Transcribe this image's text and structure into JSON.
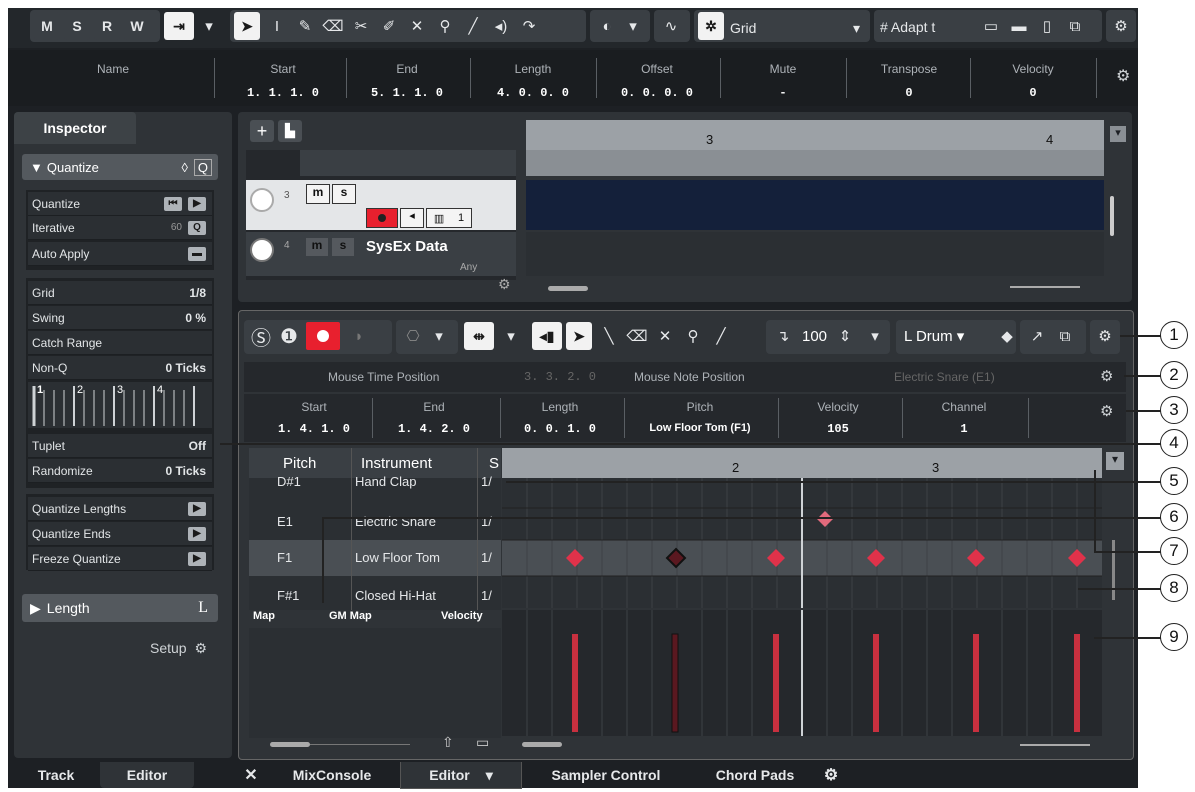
{
  "toolbar": {
    "mode_buttons": [
      "M",
      "S",
      "R",
      "W"
    ],
    "snap_type": "Grid",
    "quantize_preset": "Adapt t"
  },
  "info_line": {
    "columns": [
      {
        "label": "Name",
        "value": ""
      },
      {
        "label": "Start",
        "value": "1. 1. 1.  0"
      },
      {
        "label": "End",
        "value": "5. 1. 1.  0"
      },
      {
        "label": "Length",
        "value": "4. 0. 0.  0"
      },
      {
        "label": "Offset",
        "value": "0. 0. 0.  0"
      },
      {
        "label": "Mute",
        "value": "-"
      },
      {
        "label": "Transpose",
        "value": "0"
      },
      {
        "label": "Velocity",
        "value": "0"
      }
    ]
  },
  "inspector": {
    "tab_label": "Inspector",
    "quantize_section": "Quantize",
    "rows": [
      {
        "label": "Quantize",
        "value": ""
      },
      {
        "label": "Iterative",
        "value": "60"
      },
      {
        "label": "Auto Apply",
        "value": ""
      },
      {
        "label": "Grid",
        "value": "1/8"
      },
      {
        "label": "Swing",
        "value": "0 %"
      },
      {
        "label": "Catch Range",
        "value": ""
      },
      {
        "label": "Non-Q",
        "value": "0 Ticks"
      },
      {
        "label": "Tuplet",
        "value": "Off"
      },
      {
        "label": "Randomize",
        "value": "0 Ticks"
      },
      {
        "label": "Quantize Lengths",
        "value": ""
      },
      {
        "label": "Quantize Ends",
        "value": ""
      },
      {
        "label": "Freeze Quantize",
        "value": ""
      }
    ],
    "grid_numbers": [
      "1",
      "2",
      "3",
      "4"
    ],
    "length_section": "Length",
    "length_key": "L",
    "setup_label": "Setup"
  },
  "project": {
    "track3_number": "3",
    "track4_number": "4",
    "track4_name": "SysEx Data",
    "track4_channel": "Any",
    "track_channel": "1",
    "ruler_marks": [
      "3",
      "4"
    ]
  },
  "editor": {
    "velocity_value": "100",
    "drum_map_button": "Drum",
    "mouse_time_label": "Mouse Time Position",
    "mouse_time_value": "3. 3. 2.  0",
    "mouse_note_label": "Mouse Note Position",
    "mouse_note_value": "Electric Snare (E1)",
    "note_info": [
      {
        "label": "Start",
        "value": "1. 4. 1.  0"
      },
      {
        "label": "End",
        "value": "1. 4. 2.  0"
      },
      {
        "label": "Length",
        "value": "0. 0. 1.  0"
      },
      {
        "label": "Pitch",
        "value": "Low Floor Tom (F1)"
      },
      {
        "label": "Velocity",
        "value": "105"
      },
      {
        "label": "Channel",
        "value": "1"
      }
    ],
    "list_headers": {
      "pitch": "Pitch",
      "instrument": "Instrument",
      "s": "S"
    },
    "drum_rows": [
      {
        "pitch": "D#1",
        "instrument": "Hand Clap",
        "q": "1/"
      },
      {
        "pitch": "E1",
        "instrument": "Electric Snare",
        "q": "1/"
      },
      {
        "pitch": "F1",
        "instrument": "Low Floor Tom",
        "q": "1/"
      },
      {
        "pitch": "F#1",
        "instrument": "Closed Hi-Hat",
        "q": "1/"
      }
    ],
    "map_label": "Map",
    "map_value": "GM Map",
    "velocity_lane_label": "Velocity",
    "ruler_marks": [
      "2",
      "3"
    ]
  },
  "bottom_tabs": {
    "left": [
      "Track",
      "Editor"
    ],
    "right": [
      "MixConsole",
      "Editor",
      "Sampler Control",
      "Chord Pads"
    ]
  },
  "callouts": [
    "1",
    "2",
    "3",
    "4",
    "5",
    "6",
    "7",
    "8",
    "9"
  ],
  "colors": {
    "background": "#1d2024",
    "panel": "#2b2f33",
    "note_red": "#e0324a",
    "record_red": "#e8202e",
    "selected_row": "#4a4f54"
  }
}
